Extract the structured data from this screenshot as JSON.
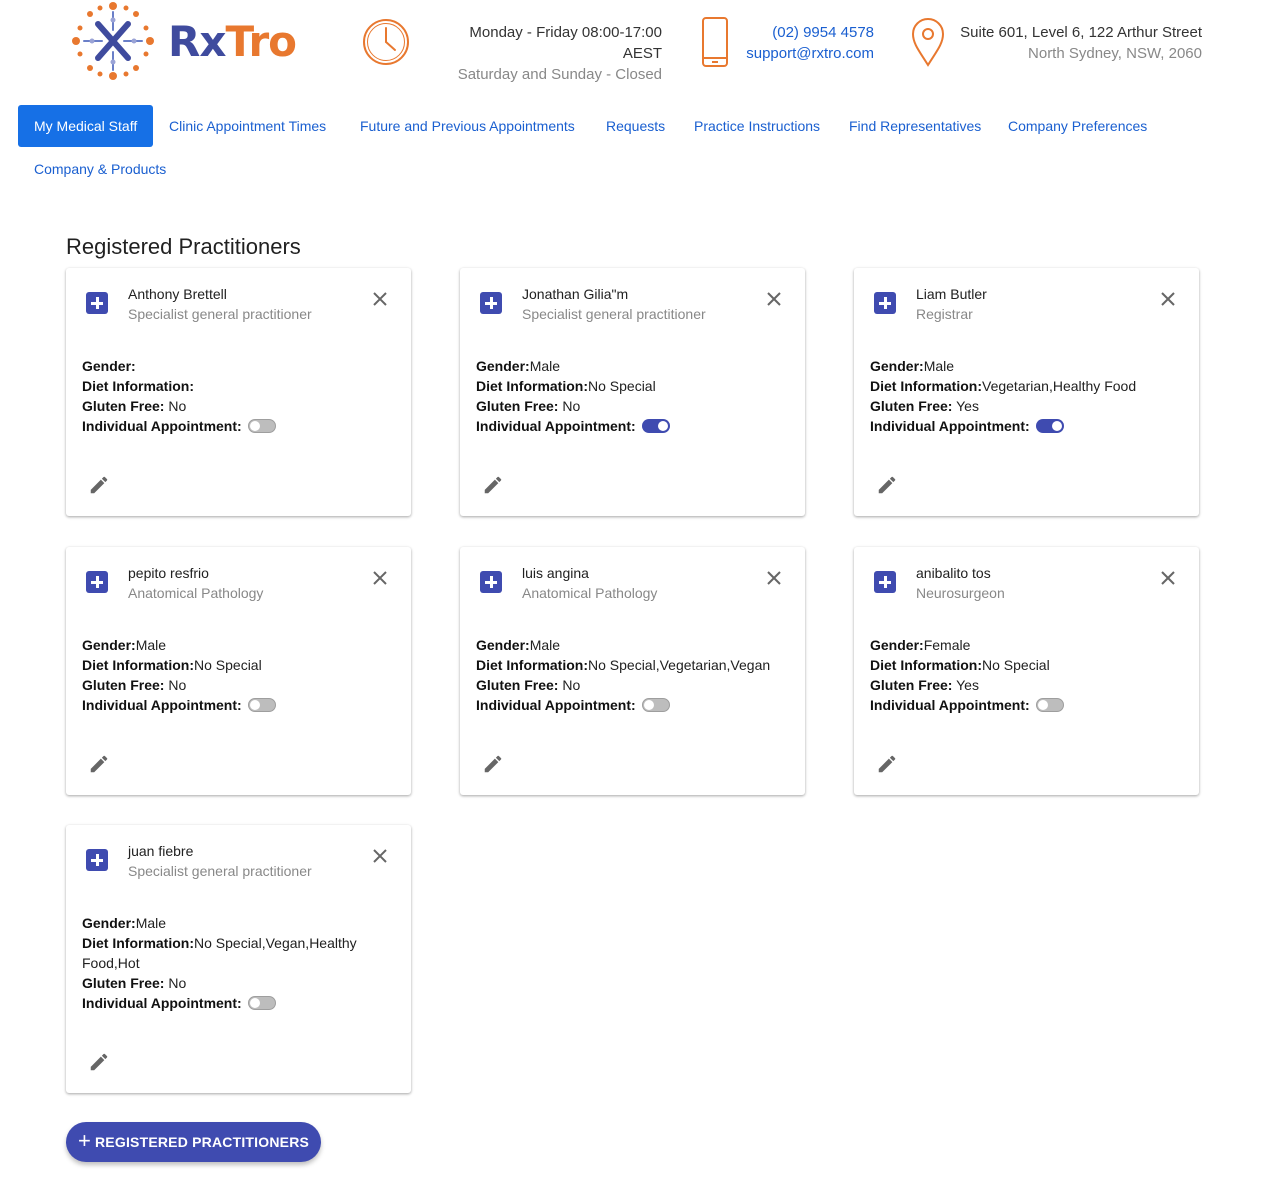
{
  "brand": {
    "rx": "Rx",
    "tro": "Tro",
    "primary": "#3f4b9e",
    "accent": "#e8782f"
  },
  "header": {
    "hours_line1": "Monday - Friday 08:00-17:00 AEST",
    "hours_line2": "Saturday and Sunday - Closed",
    "phone": "(02) 9954 4578",
    "email": "support@rxtro.com",
    "address_line1": "Suite 601, Level 6, 122 Arthur Street",
    "address_line2": "North Sydney, NSW, 2060",
    "icons": [
      "clock-icon",
      "phone-icon",
      "location-pin-icon"
    ]
  },
  "nav": {
    "items": [
      "My Medical Staff",
      "Clinic Appointment Times",
      "Future and Previous Appointments",
      "Requests",
      "Practice Instructions",
      "Find Representatives",
      "Company Preferences",
      "Company & Products"
    ],
    "active": "My Medical Staff"
  },
  "section_title": "Registered Practitioners",
  "labels": {
    "gender": "Gender:",
    "diet": "Diet Information:",
    "gluten": "Gluten Free:",
    "individual": "Individual Appointment:"
  },
  "practitioners": [
    {
      "name": "Anthony Brettell",
      "role": "Specialist general practitioner",
      "gender": "",
      "diet": "",
      "gluten": " No",
      "individual": false
    },
    {
      "name": "Jonathan Gilia\"m",
      "role": "Specialist general practitioner",
      "gender": "Male",
      "diet": "No Special",
      "gluten": " No",
      "individual": true
    },
    {
      "name": "Liam Butler",
      "role": "Registrar",
      "gender": "Male",
      "diet": "Vegetarian,Healthy Food",
      "gluten": " Yes",
      "individual": true
    },
    {
      "name": "pepito resfrio",
      "role": "Anatomical Pathology",
      "gender": "Male",
      "diet": "No Special",
      "gluten": " No",
      "individual": false
    },
    {
      "name": "luis angina",
      "role": "Anatomical Pathology",
      "gender": "Male",
      "diet": "No Special,Vegetarian,Vegan",
      "gluten": " No",
      "individual": false
    },
    {
      "name": "anibalito tos",
      "role": "Neurosurgeon",
      "gender": "Female",
      "diet": "No Special",
      "gluten": " Yes",
      "individual": false
    },
    {
      "name": "juan fiebre",
      "role": "Specialist general practitioner",
      "gender": "Male",
      "diet": "No Special,Vegan,Healthy Food,Hot",
      "gluten": " No",
      "individual": false
    }
  ],
  "add_button": "REGISTERED PRACTITIONERS"
}
